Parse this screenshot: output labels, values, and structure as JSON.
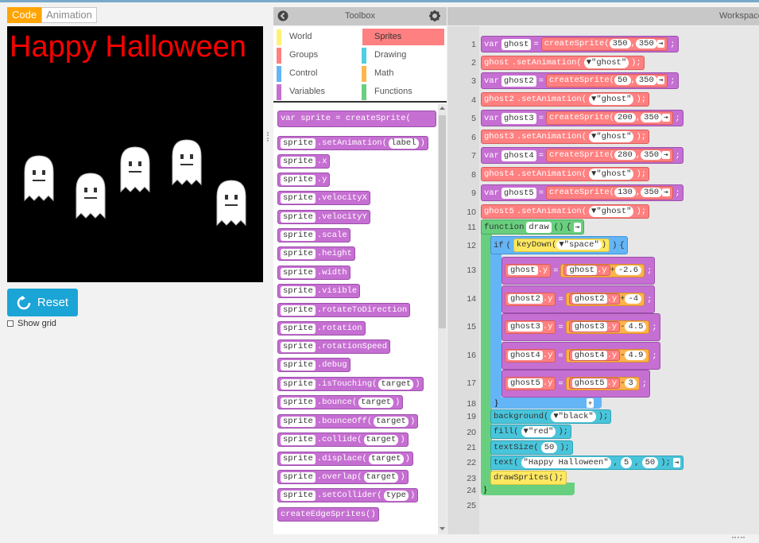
{
  "tabs": {
    "code": "Code",
    "animation": "Animation"
  },
  "stage": {
    "title_text": "Happy Halloween",
    "title_color": "#ff0000",
    "background": "#000000"
  },
  "reset_label": "Reset",
  "show_grid_label": "Show grid",
  "toolbox": {
    "title": "Toolbox",
    "categories": [
      {
        "label": "World",
        "color": "#fff176"
      },
      {
        "label": "Sprites",
        "color": "#ff8080",
        "selected": true
      },
      {
        "label": "Groups",
        "color": "#ff8080"
      },
      {
        "label": "Drawing",
        "color": "#4dd0e1"
      },
      {
        "label": "Control",
        "color": "#64b5f6"
      },
      {
        "label": "Math",
        "color": "#ffb74d"
      },
      {
        "label": "Variables",
        "color": "#c66fd2"
      },
      {
        "label": "Functions",
        "color": "#68cf7e"
      }
    ],
    "blocks": [
      "var sprite = createSprite(",
      "sprite.setAnimation(label)",
      "sprite.x",
      "sprite.y",
      "sprite.velocityX",
      "sprite.velocityY",
      "sprite.scale",
      "sprite.height",
      "sprite.width",
      "sprite.visible",
      "sprite.rotateToDirection",
      "sprite.rotation",
      "sprite.rotationSpeed",
      "sprite.debug",
      "sprite.isTouching(target)",
      "sprite.bounce(target)",
      "sprite.bounceOff(target)",
      "sprite.collide(target)",
      "sprite.displace(target)",
      "sprite.overlap(target)",
      "sprite.setCollider(type)",
      "createEdgeSprites()"
    ]
  },
  "workspace": {
    "title": "Workspace",
    "line_numbers": [
      "1",
      "2",
      "3",
      "4",
      "5",
      "6",
      "7",
      "8",
      "9",
      "10",
      "11",
      "12",
      "13",
      "14",
      "15",
      "16",
      "17",
      "18",
      "19",
      "20",
      "21",
      "22",
      "23",
      "24",
      "25"
    ],
    "ghosts": [
      {
        "name": "ghost",
        "x": "350",
        "y": "350",
        "dy": "-2.6",
        "op": "+"
      },
      {
        "name": "ghost2",
        "x": "50",
        "y": "350",
        "dy": "-4",
        "op": "+"
      },
      {
        "name": "ghost3",
        "x": "200",
        "y": "350",
        "dy": "4.5",
        "op": "-"
      },
      {
        "name": "ghost4",
        "x": "280",
        "y": "350",
        "dy": "4.9",
        "op": "-"
      },
      {
        "name": "ghost5",
        "x": "130",
        "y": "350",
        "dy": "3",
        "op": "-"
      }
    ],
    "anim_name": "\"ghost\"",
    "func_name": "draw",
    "key": "\"space\"",
    "bg_color": "\"black\"",
    "fill_color": "\"red\"",
    "text_size": "50",
    "text_str": "\"Happy Halloween\"",
    "text_x": "5",
    "text_y": "50"
  }
}
